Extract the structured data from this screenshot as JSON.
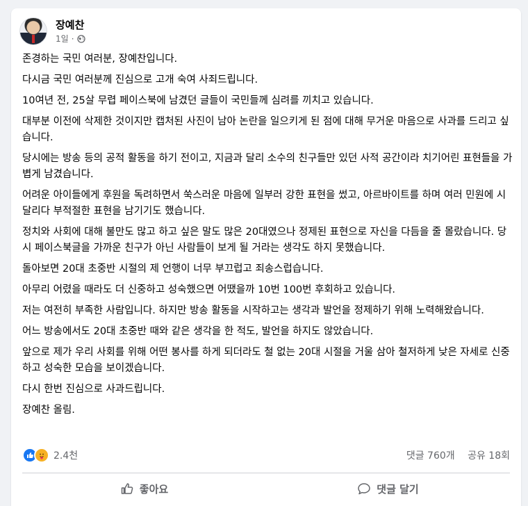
{
  "post": {
    "author": "장예찬",
    "time": "1일",
    "separator": "·",
    "paragraphs": [
      "존경하는 국민 여러분, 장예찬입니다.",
      "다시금 국민 여러분께 진심으로 고개 숙여 사죄드립니다.",
      "10여년 전, 25살 무렵 페이스북에 남겼던 글들이 국민들께 심려를 끼치고 있습니다.",
      "대부분 이전에 삭제한 것이지만 캡처된 사진이 남아 논란을 일으키게 된 점에 대해 무거운 마음으로 사과를 드리고 싶습니다.",
      "당시에는 방송 등의 공적 활동을 하기 전이고, 지금과 달리 소수의 친구들만 있던 사적 공간이라 치기어린 표현들을 가볍게 남겼습니다.",
      "어려운 아이들에게 후원을 독려하면서 쑥스러운 마음에 일부러 강한 표현을 썼고, 아르바이트를 하며 여러 민원에 시달리다 부적절한 표현을 남기기도 했습니다.",
      "정치와 사회에 대해 불만도 많고 하고 싶은 말도 많은 20대였으나 정제된 표현으로 자신을 다듬을 줄 몰랐습니다. 당시 페이스북글을 가까운 친구가 아닌 사람들이 보게 될 거라는 생각도 하지 못했습니다.",
      "돌아보면 20대 초중반 시절의 제 언행이 너무 부끄럽고 죄송스럽습니다.",
      "아무리 어렸을 때라도 더 신중하고 성숙했으면 어땠을까 10번 100번 후회하고 있습니다.",
      "저는 여전히 부족한 사람입니다. 하지만 방송 활동을 시작하고는 생각과 발언을 정제하기 위해 노력해왔습니다.",
      "어느 방송에서도 20대 초중반 때와 같은 생각을 한 적도, 발언을 하지도 않았습니다.",
      "앞으로 제가 우리 사회를 위해 어떤 봉사를 하게 되더라도 철 없는 20대 시절을 거울 삼아 철저하게 낮은 자세로 신중하고 성숙한 모습을 보이겠습니다.",
      "다시 한번 진심으로 사과드립니다.",
      "장예찬 올림."
    ]
  },
  "stats": {
    "reactions": "2.4천",
    "comments": "댓글 760개",
    "shares": "공유 18회"
  },
  "actions": {
    "like": "좋아요",
    "comment": "댓글 달기"
  },
  "colors": {
    "brand_blue": "#1877f2",
    "secondary_text": "#65676b",
    "care_yellow": "#f7b125"
  },
  "icons": [
    "globe-icon",
    "like-reaction-icon",
    "care-reaction-icon",
    "thumbs-up-icon",
    "comment-icon"
  ]
}
